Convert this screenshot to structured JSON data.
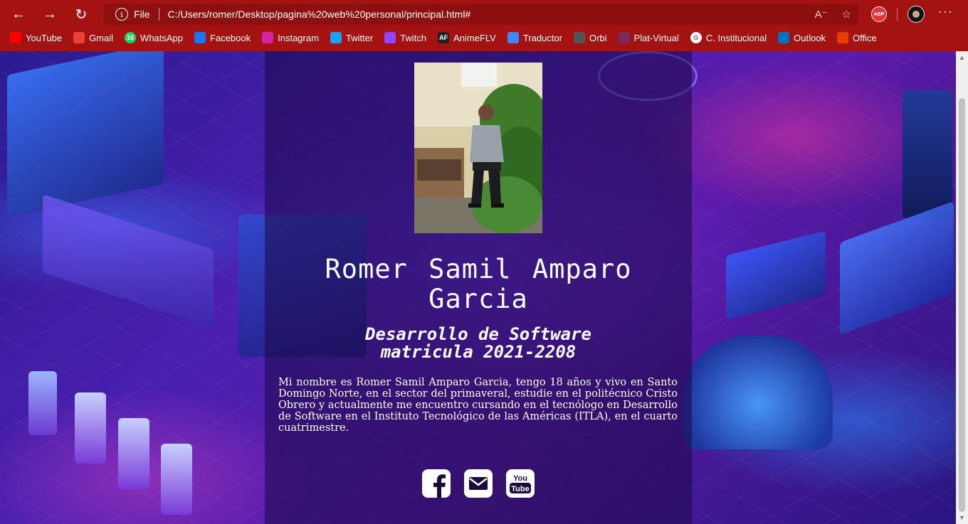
{
  "browser": {
    "scheme_label": "File",
    "url": "C:/Users/romer/Desktop/pagina%20web%20personal/principal.html#",
    "extension_label": "ABP",
    "bookmarks": [
      {
        "label": "YouTube",
        "icon": "youtube-icon",
        "color": "#ff0000"
      },
      {
        "label": "Gmail",
        "icon": "gmail-icon",
        "color": "#ea4335"
      },
      {
        "label": "WhatsApp",
        "icon": "whatsapp-icon",
        "color": "#25d366",
        "badge": "16"
      },
      {
        "label": "Facebook",
        "icon": "facebook-icon",
        "color": "#1877f2"
      },
      {
        "label": "Instagram",
        "icon": "instagram-icon",
        "color": "#d6249f"
      },
      {
        "label": "Twitter",
        "icon": "twitter-icon",
        "color": "#1da1f2"
      },
      {
        "label": "Twitch",
        "icon": "twitch-icon",
        "color": "#9146ff"
      },
      {
        "label": "AnimeFLV",
        "icon": "animeflv-icon",
        "color": "#222222",
        "badge": "AF"
      },
      {
        "label": "Traductor",
        "icon": "translate-icon",
        "color": "#4285f4"
      },
      {
        "label": "Orbi",
        "icon": "orbi-icon",
        "color": "#555555"
      },
      {
        "label": "Plat-Virtual",
        "icon": "plat-virtual-icon",
        "color": "#7a2a5a"
      },
      {
        "label": "C. Institucional",
        "icon": "google-icon",
        "color": "#ffffff"
      },
      {
        "label": "Outlook",
        "icon": "outlook-icon",
        "color": "#0072c6"
      },
      {
        "label": "Office",
        "icon": "office-icon",
        "color": "#eb3c00"
      }
    ]
  },
  "profile": {
    "name": "Romer Samil Amparo Garcia",
    "subtitle_line1": "Desarrollo de Software",
    "subtitle_line2": "matricula 2021-2208",
    "bio": "Mi nombre es Romer Samil Amparo Garcia, tengo 18 años y vivo en Santo Domingo Norte, en el sector del primaveral, estudie en el politécnico Cristo Obrero y actualmente me encuentro cursando en el tecnólogo en Desarrollo de Software en el Instituto Tecnológico de las Américas (ITLA), en el cuarto cuatrimestre."
  },
  "social": [
    {
      "name": "facebook-icon"
    },
    {
      "name": "email-icon"
    },
    {
      "name": "youtube-icon",
      "label_top": "You",
      "label_bottom": "Tube"
    }
  ],
  "colors": {
    "chrome": "#a51212",
    "address_bar": "#8e0f0f",
    "accent_purple": "#4a1fb0"
  }
}
